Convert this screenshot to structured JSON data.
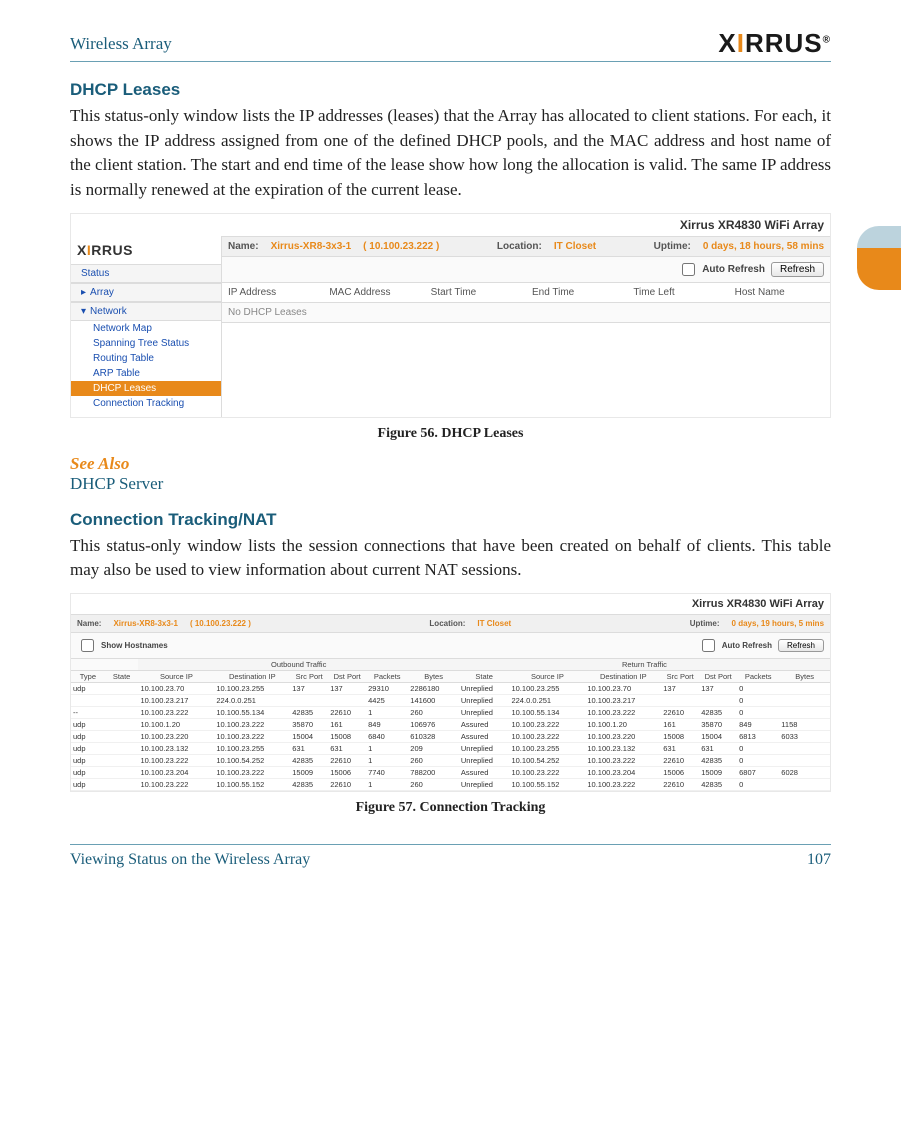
{
  "header": {
    "doc_title": "Wireless Array",
    "brand_raw": "XIRRUS"
  },
  "sections": {
    "dhcp_heading": "DHCP Leases",
    "dhcp_body": "This status-only window lists the IP addresses (leases) that the Array has allocated to client stations. For each, it shows the IP address assigned from one of the defined DHCP pools, and the MAC address and host name of the client station. The start and end time of the lease show how long the allocation is valid. The same IP address is normally renewed at the expiration of the current lease.",
    "fig56": "Figure 56. DHCP Leases",
    "see_also": "See Also",
    "see_link": "DHCP Server",
    "ct_heading": "Connection Tracking/NAT",
    "ct_body": "This status-only window lists the session connections that have been created on behalf of clients. This table may also be used to view information about current NAT sessions.",
    "fig57": "Figure 57. Connection Tracking"
  },
  "dhcp_ui": {
    "device_title": "Xirrus XR4830 WiFi Array",
    "name_label": "Name:",
    "name_value": "Xirrus-XR8-3x3-1",
    "name_ip": "( 10.100.23.222 )",
    "location_label": "Location:",
    "location_value": "IT Closet",
    "uptime_label": "Uptime:",
    "uptime_value": "0 days, 18 hours, 58 mins",
    "auto_refresh": "Auto Refresh",
    "refresh_btn": "Refresh",
    "nav": {
      "status": "Status",
      "array": "Array",
      "network": "Network",
      "items": [
        "Network Map",
        "Spanning Tree Status",
        "Routing Table",
        "ARP Table",
        "DHCP Leases",
        "Connection Tracking"
      ],
      "active_index": 4
    },
    "columns": [
      "IP Address",
      "MAC Address",
      "Start Time",
      "End Time",
      "Time Left",
      "Host Name"
    ],
    "empty": "No DHCP Leases"
  },
  "ct_ui": {
    "device_title": "Xirrus XR4830 WiFi Array",
    "name_label": "Name:",
    "name_value": "Xirrus-XR8-3x3-1",
    "name_ip": "( 10.100.23.222 )",
    "location_label": "Location:",
    "location_value": "IT Closet",
    "uptime_label": "Uptime:",
    "uptime_value": "0 days, 19 hours, 5 mins",
    "show_hostnames": "Show Hostnames",
    "auto_refresh": "Auto Refresh",
    "refresh_btn": "Refresh",
    "group_out": "Outbound Traffic",
    "group_ret": "Return Traffic",
    "columns": [
      "Type",
      "State",
      "Source IP",
      "Destination IP",
      "Src Port",
      "Dst Port",
      "Packets",
      "Bytes",
      "State",
      "Source IP",
      "Destination IP",
      "Src Port",
      "Dst Port",
      "Packets",
      "Bytes"
    ],
    "rows": [
      [
        "udp",
        "",
        "10.100.23.70",
        "10.100.23.255",
        "137",
        "137",
        "29310",
        "2286180",
        "Unreplied",
        "10.100.23.255",
        "10.100.23.70",
        "137",
        "137",
        "0",
        ""
      ],
      [
        "",
        "",
        "10.100.23.217",
        "224.0.0.251",
        "",
        "",
        "4425",
        "141600",
        "Unreplied",
        "224.0.0.251",
        "10.100.23.217",
        "",
        "",
        "0",
        ""
      ],
      [
        "--",
        "",
        "10.100.23.222",
        "10.100.55.134",
        "42835",
        "22610",
        "1",
        "260",
        "Unreplied",
        "10.100.55.134",
        "10.100.23.222",
        "22610",
        "42835",
        "0",
        ""
      ],
      [
        "udp",
        "",
        "10.100.1.20",
        "10.100.23.222",
        "35870",
        "161",
        "849",
        "106976",
        "Assured",
        "10.100.23.222",
        "10.100.1.20",
        "161",
        "35870",
        "849",
        "1158"
      ],
      [
        "udp",
        "",
        "10.100.23.220",
        "10.100.23.222",
        "15004",
        "15008",
        "6840",
        "610328",
        "Assured",
        "10.100.23.222",
        "10.100.23.220",
        "15008",
        "15004",
        "6813",
        "6033"
      ],
      [
        "udp",
        "",
        "10.100.23.132",
        "10.100.23.255",
        "631",
        "631",
        "1",
        "209",
        "Unreplied",
        "10.100.23.255",
        "10.100.23.132",
        "631",
        "631",
        "0",
        ""
      ],
      [
        "udp",
        "",
        "10.100.23.222",
        "10.100.54.252",
        "42835",
        "22610",
        "1",
        "260",
        "Unreplied",
        "10.100.54.252",
        "10.100.23.222",
        "22610",
        "42835",
        "0",
        ""
      ],
      [
        "udp",
        "",
        "10.100.23.204",
        "10.100.23.222",
        "15009",
        "15006",
        "7740",
        "788200",
        "Assured",
        "10.100.23.222",
        "10.100.23.204",
        "15006",
        "15009",
        "6807",
        "6028"
      ],
      [
        "udp",
        "",
        "10.100.23.222",
        "10.100.55.152",
        "42835",
        "22610",
        "1",
        "260",
        "Unreplied",
        "10.100.55.152",
        "10.100.23.222",
        "22610",
        "42835",
        "0",
        ""
      ]
    ]
  },
  "footer": {
    "left": "Viewing Status on the Wireless Array",
    "page": "107"
  }
}
